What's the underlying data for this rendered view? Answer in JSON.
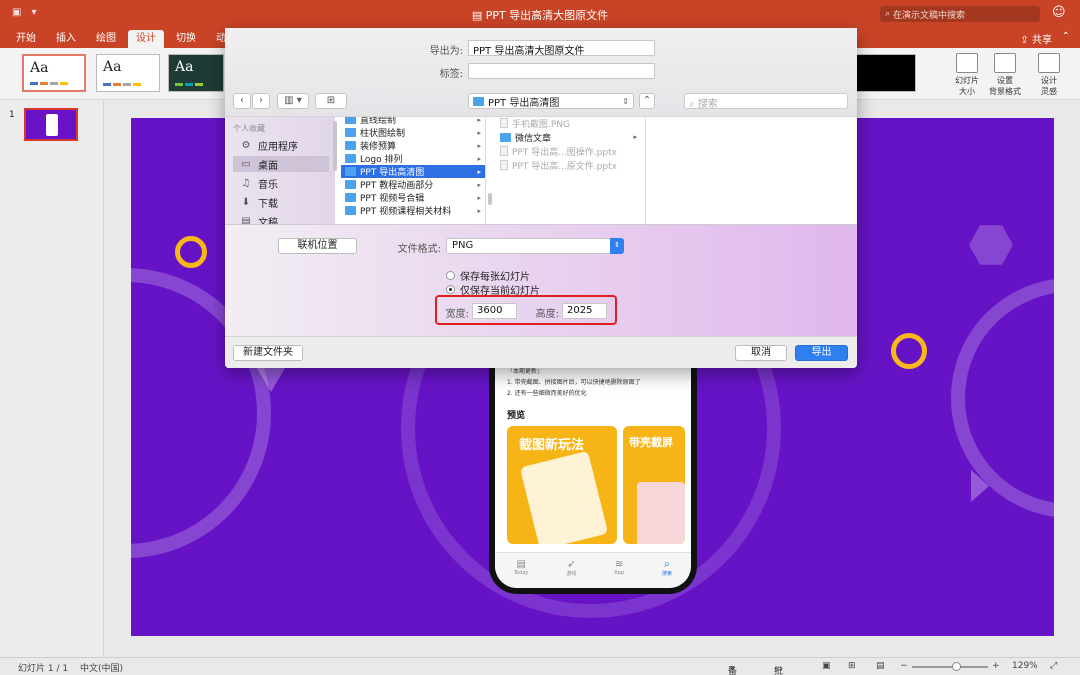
{
  "app": {
    "title": "PPT 导出高清大图原文件",
    "search_placeholder": "在演示文稿中搜索"
  },
  "ribbon": {
    "tabs": [
      "开始",
      "插入",
      "绘图",
      "设计",
      "切换",
      "动"
    ],
    "active_tab": "设计",
    "share_label": "共享",
    "theme_label": "Aa",
    "buttons": {
      "slide_size": "幻灯片\n大小",
      "format_bg": "设置\n背景格式",
      "design_ideas": "设计\n灵感"
    }
  },
  "thumbs": {
    "slide_number": "1"
  },
  "dialog": {
    "export_as_label": "导出为:",
    "export_as_value": "PPT 导出高清大图原文件",
    "tags_label": "标签:",
    "tags_value": "",
    "location": "PPT 导出高清图",
    "search_placeholder": "搜索",
    "sidebar": {
      "section": "个人收藏",
      "items": [
        "应用程序",
        "桌面",
        "音乐",
        "下载",
        "文稿"
      ],
      "selected": "桌面"
    },
    "column1": [
      "直线绘制",
      "柱状图绘制",
      "装修预算",
      "Logo 排列",
      "PPT 导出高清图",
      "PPT 教程动画部分",
      "PPT 视频号合辑",
      "PPT 视频课程相关材料"
    ],
    "column1_selected": "PPT 导出高清图",
    "column2": {
      "dim_top": "手机截图.PNG",
      "folder": "微信文章",
      "file1": "PPT 导出高...图操作.pptx",
      "file2": "PPT 导出高...原文件.pptx"
    },
    "online_locations": "联机位置",
    "format_label": "文件格式:",
    "format_value": "PNG",
    "radio_all": "保存每张幻灯片",
    "radio_current": "仅保存当前幻灯片",
    "width_label": "宽度:",
    "width_value": "3600",
    "height_label": "高度:",
    "height_value": "2025",
    "new_folder": "新建文件夹",
    "cancel": "取消",
    "export": "导出"
  },
  "slide": {
    "phone": {
      "update_title": "「本期更新」",
      "update_line1": "1. 带壳截图、拼接图片后，可以快捷地删除原图了",
      "update_line2": "2. 还有一些细微而美好的优化",
      "preview": "预览",
      "card1": "截图新玩法",
      "card2": "带壳截屏",
      "tabs": [
        "Today",
        "游戏",
        "App",
        "搜索"
      ]
    }
  },
  "status": {
    "slide_pos": "幻灯片 1 / 1",
    "language": "中文(中国)",
    "notes": "备注",
    "comments": "批注",
    "zoom": "129%"
  },
  "colors": {
    "accent": "#c94427",
    "slide_bg": "#6613c6",
    "highlight_box": "#e02020",
    "primary_button": "#2f7ff0"
  }
}
